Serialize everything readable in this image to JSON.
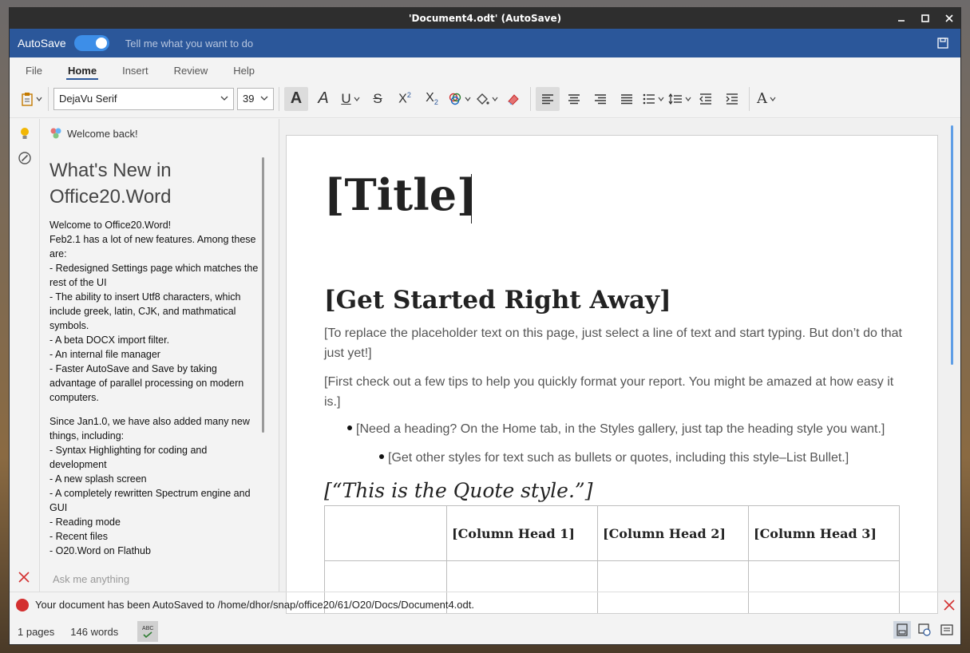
{
  "window": {
    "title": "'Document4.odt'  (AutoSave)"
  },
  "bluebar": {
    "autosave_label": "AutoSave",
    "autosave_on": true,
    "tell_me_placeholder": "Tell me what you want to do"
  },
  "menu": {
    "tabs": [
      "File",
      "Home",
      "Insert",
      "Review",
      "Help"
    ],
    "active": "Home"
  },
  "toolbar": {
    "font_family": "DejaVu Serif",
    "font_size": "39"
  },
  "side_panel": {
    "welcome": "Welcome back!",
    "title": "What's New in Office20.Word",
    "para1": [
      "Welcome to Office20.Word!",
      "Feb2.1 has a lot of new features. Among these are:",
      "- Redesigned Settings page which matches the rest of the UI",
      "- The ability to insert Utf8 characters, which include greek, latin, CJK, and mathmatical symbols.",
      "- A beta DOCX import filter.",
      "- An internal file manager",
      "- Faster AutoSave and Save by taking advantage of parallel processing on modern computers."
    ],
    "para2": [
      "Since Jan1.0, we have also added many new things, including:",
      "- Syntax Highlighting for coding and development",
      "- A new splash screen",
      "- A completely rewritten Spectrum engine and GUI",
      "- Reading mode",
      "- Recent files",
      "- O20.Word on Flathub"
    ],
    "ask_placeholder": "Ask me anything"
  },
  "document": {
    "title": "[Title]",
    "heading": "[Get Started Right Away]",
    "para1": "[To replace the placeholder text on this page, just select a line of text and start typing. But don’t do that just yet!]",
    "para2": "[First check out a few tips to help you quickly format your report. You might be amazed at how easy it is.]",
    "bullet1": "[Need a heading? On the Home tab, in the Styles gallery, just tap the heading style you want.]",
    "bullet2": "[Get other styles for text such as bullets or quotes, including this style–List Bullet.]",
    "quote": "[“This is the Quote style.”]",
    "table_headers": [
      "",
      "[Column Head 1]",
      "[Column Head 2]",
      "[Column Head 3]"
    ]
  },
  "status": {
    "message": "Your document has been AutoSaved to /home/dhor/snap/office20/61/O20/Docs/Document4.odt.",
    "pages": "1 pages",
    "words": "146 words",
    "spell_label": "ABC"
  },
  "colors": {
    "accent": "#2b579a",
    "titlebar": "#2e2e2e",
    "toggle": "#3d8ee8",
    "close_red": "#d32f2f"
  }
}
